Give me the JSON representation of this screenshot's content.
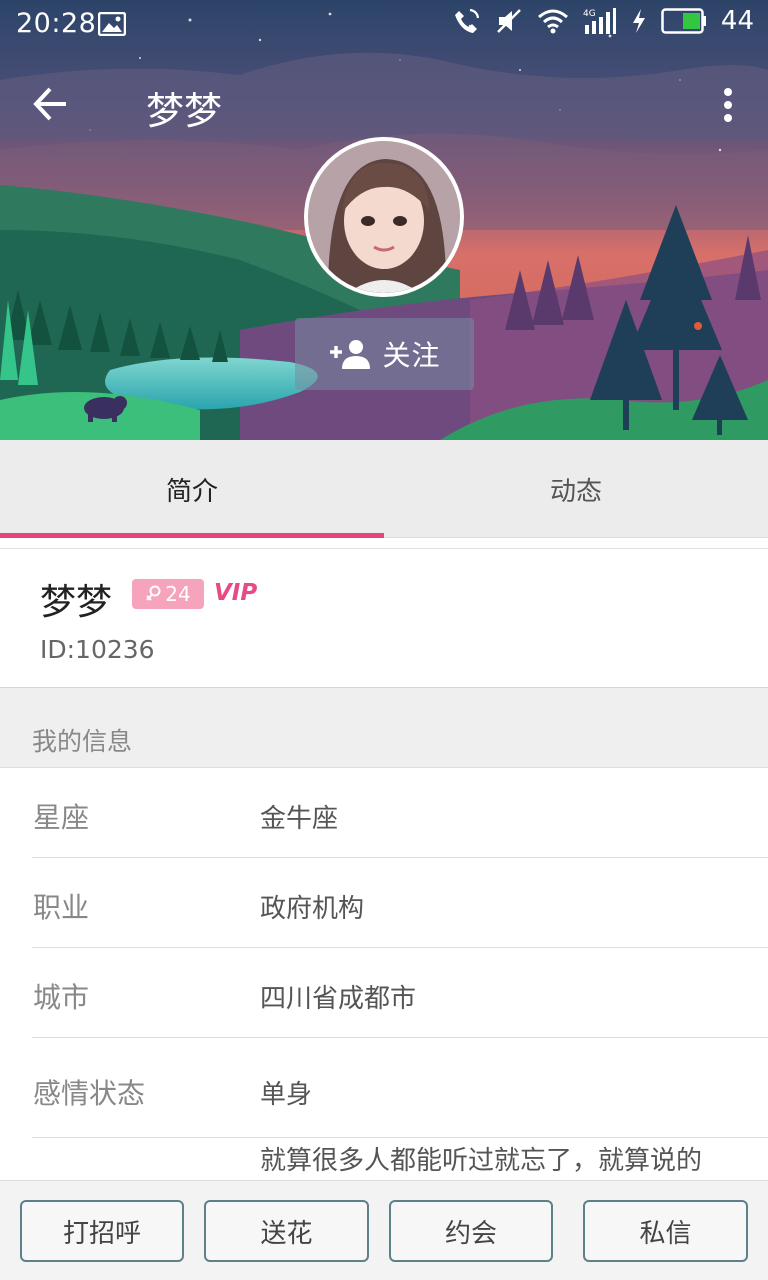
{
  "status_bar": {
    "time": "20:28",
    "battery": "44",
    "icons": [
      "gallery-icon",
      "phone-signal-icon",
      "mute-icon",
      "wifi-icon",
      "4g-signal-icon",
      "charging-icon",
      "battery-icon"
    ]
  },
  "header": {
    "title": "梦梦",
    "back_icon": "arrow-left-icon",
    "more_icon": "more-vertical-icon",
    "follow_label": "关注",
    "follow_icon": "add-person-icon"
  },
  "tabs": [
    {
      "label": "简介",
      "active": true
    },
    {
      "label": "动态",
      "active": false
    }
  ],
  "profile": {
    "name": "梦梦",
    "age": "24",
    "gender_icon": "female-icon",
    "vip": "VIP",
    "id": "ID:10236"
  },
  "info": {
    "section_title": "我的信息",
    "rows": [
      {
        "key": "星座",
        "value": "金牛座"
      },
      {
        "key": "职业",
        "value": "政府机构"
      },
      {
        "key": "城市",
        "value": "四川省成都市"
      },
      {
        "key": "感情状态",
        "value": "单身"
      }
    ],
    "bio": "就算很多人都能听过就忘了，就算说的"
  },
  "actions": [
    {
      "label": "打招呼"
    },
    {
      "label": "送花"
    },
    {
      "label": "约会"
    },
    {
      "label": "私信"
    }
  ],
  "colors": {
    "accent": "#e8457f",
    "vip": "#e64b86",
    "age_badge": "#f6a4bb",
    "button_border": "#5d8089"
  }
}
